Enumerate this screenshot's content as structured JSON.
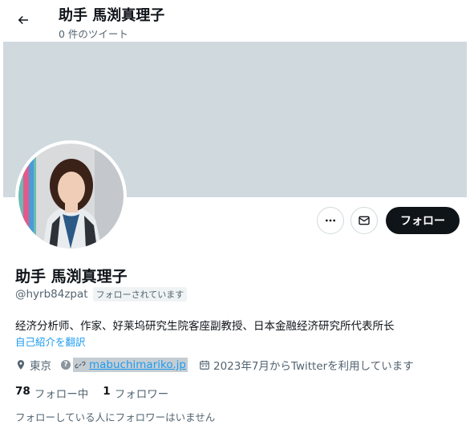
{
  "header": {
    "title": "助手 馬渕真理子",
    "tweet_count": "0 件のツイート",
    "back_icon": "arrow-left-icon"
  },
  "colors": {
    "banner": "#cfd9de",
    "accent": "#1d9bf0",
    "follow_button": "#0f1419",
    "secondary_text": "#536471"
  },
  "profile": {
    "name": "助手 馬渕真理子",
    "handle": "@hyrb84zpat",
    "follows_you": "フォローされています",
    "bio": "经济分析师、作家、好莱坞研究生院客座副教授、日本金融经济研究所代表所长",
    "translate": "自己紹介を翻訳",
    "location": "東京",
    "url": "mabuchimariko.jp",
    "joined": "2023年7月からTwitterを利用しています"
  },
  "actions": {
    "more_icon": "more-horizontal-icon",
    "message_icon": "envelope-icon",
    "follow_label": "フォロー"
  },
  "stats": {
    "following_count": "78",
    "following_label": "フォロー中",
    "followers_count": "1",
    "followers_label": "フォロワー"
  },
  "mutual_note": "フォローしている人にフォロワーはいません"
}
